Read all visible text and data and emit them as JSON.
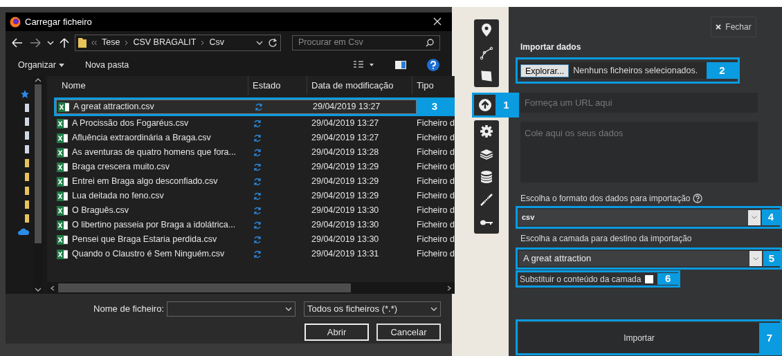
{
  "dialog": {
    "title": "Carregar ficheiro",
    "breadcrumb": [
      "Tese",
      "CSV BRAGALIT",
      "Csv"
    ],
    "search": {
      "placeholder": "Procurar em Csv"
    },
    "toolbar": [
      "Organizar",
      "Nova pasta"
    ],
    "columns": [
      "Nome",
      "Estado",
      "Data de modificação",
      "Tipo"
    ],
    "files": [
      {
        "name": "A great attraction.csv",
        "date": "29/04/2019 13:27",
        "selected": true,
        "callout": "3"
      },
      {
        "name": "A Procissão dos Fogaréus.csv",
        "date": "29/04/2019 13:27",
        "type": "Ficheiro d",
        "selected": false
      },
      {
        "name": "Afluência extraordinária a Braga.csv",
        "date": "29/04/2019 13:27",
        "type": "Ficheiro d",
        "selected": false
      },
      {
        "name": "As aventuras de quatro homens que fora...",
        "date": "29/04/2019 13:28",
        "type": "Ficheiro d",
        "selected": false
      },
      {
        "name": "Braga crescera muito.csv",
        "date": "29/04/2019 13:29",
        "type": "Ficheiro d",
        "selected": false
      },
      {
        "name": "Entrei em Braga algo desconfiado.csv",
        "date": "29/04/2019 13:29",
        "type": "Ficheiro d",
        "selected": false
      },
      {
        "name": "Lua deitada no feno.csv",
        "date": "29/04/2019 13:29",
        "type": "Ficheiro d",
        "selected": false
      },
      {
        "name": "O Braguês.csv",
        "date": "29/04/2019 13:30",
        "type": "Ficheiro d",
        "selected": false
      },
      {
        "name": "O libertino passeia por Braga a idolátrica...",
        "date": "29/04/2019 13:30",
        "type": "Ficheiro d",
        "selected": false
      },
      {
        "name": "Pensei que Braga Estaria perdida.csv",
        "date": "29/04/2019 13:30",
        "type": "Ficheiro d",
        "selected": false
      },
      {
        "name": "Quando o Claustro é Sem Ninguém.csv",
        "date": "29/04/2019 13:31",
        "type": "Ficheiro d",
        "selected": false
      }
    ],
    "filename_label": "Nome de ficheiro:",
    "filter": "Todos os ficheiros (*.*)",
    "buttons": [
      "Abrir",
      "Cancelar"
    ]
  },
  "tools": [
    {
      "kind": "marker",
      "selected": false
    },
    {
      "kind": "line",
      "selected": false
    },
    {
      "kind": "polygon",
      "selected": false
    },
    {
      "kind": "upload",
      "selected": true,
      "callout": "1"
    },
    {
      "kind": "settings",
      "selected": false
    },
    {
      "kind": "layers",
      "selected": false
    },
    {
      "kind": "database",
      "selected": false
    },
    {
      "kind": "arrows",
      "selected": false
    },
    {
      "kind": "key",
      "selected": false
    }
  ],
  "panel": {
    "close": "Fechar",
    "heading": "Importar dados",
    "browse_button": "Explorar...",
    "file_status": "Nenhuns ficheiros selecionados.",
    "browse_callout": "2",
    "url": {
      "placeholder": "Forneça um URL aqui"
    },
    "paste": {
      "placeholder": "Cole aqui os seus dados"
    },
    "format_label": "Escolha o formato dos dados para importação",
    "format_value": "csv",
    "format_callout": "4",
    "layer_label": "Escolha a camada para destino da importação",
    "layer_value": "A great attraction",
    "layer_callout": "5",
    "replace_label": "Substituir o conteúdo da camada",
    "replace_checked": false,
    "replace_callout": "6",
    "import_button": "Importar",
    "import_callout": "7"
  }
}
